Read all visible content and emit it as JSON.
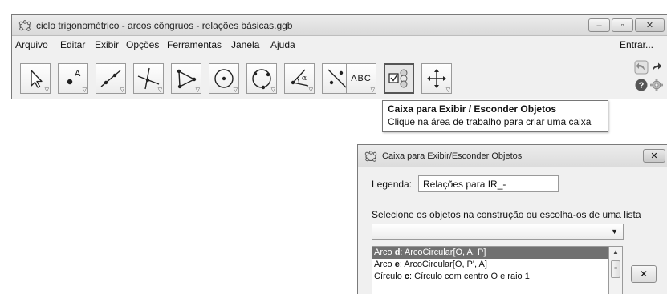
{
  "window": {
    "title": "ciclo trigonométrico - arcos côngruos - relações básicas.ggb",
    "minimize": "–",
    "maximize": "▫",
    "close": "✕"
  },
  "menu": {
    "items": [
      "Arquivo",
      "Editar",
      "Exibir",
      "Opções",
      "Ferramentas",
      "Janela",
      "Ajuda"
    ],
    "login": "Entrar..."
  },
  "toolbar": {
    "tools": [
      {
        "icon": "move-arrow-icon"
      },
      {
        "icon": "point-icon",
        "label": "A"
      },
      {
        "icon": "line-icon"
      },
      {
        "icon": "perpendicular-line-icon"
      },
      {
        "icon": "polygon-icon"
      },
      {
        "icon": "circle-center-icon"
      },
      {
        "icon": "circle-three-points-icon"
      },
      {
        "icon": "angle-icon",
        "label": "α"
      },
      {
        "icon": "reflect-line-icon"
      },
      {
        "icon": "text-icon",
        "label": "ABC"
      },
      {
        "icon": "checkbox-show-hide-icon",
        "active": true
      },
      {
        "icon": "move-graphics-view-icon"
      }
    ],
    "side_icons": [
      "undo-icon",
      "redo-icon",
      "help-icon",
      "settings-icon"
    ]
  },
  "tooltip": {
    "title": "Caixa para Exibir / Esconder Objetos",
    "body": "Clique na área de trabalho para criar uma caixa"
  },
  "dialog": {
    "title": "Caixa para Exibir/Esconder Objetos",
    "close": "✕",
    "legend_label": "Legenda:",
    "legend_value": "Relações para IR_-",
    "select_label": "Selecione os objetos na construção ou escolha-os de uma lista",
    "select_value": "",
    "objects": [
      {
        "pre": "Arco ",
        "name": "d",
        "post": ": ArcoCircular[O, A, P]",
        "selected": true
      },
      {
        "pre": "Arco ",
        "name": "e",
        "post": ": ArcoCircular[O, P', A]",
        "selected": false
      },
      {
        "pre": "Círculo ",
        "name": "c",
        "post": ": Círculo com centro O e raio 1",
        "selected": false
      }
    ],
    "remove_button": "✕"
  },
  "colors": {
    "selection": "#707070",
    "chrome": "#f0f0f0"
  }
}
